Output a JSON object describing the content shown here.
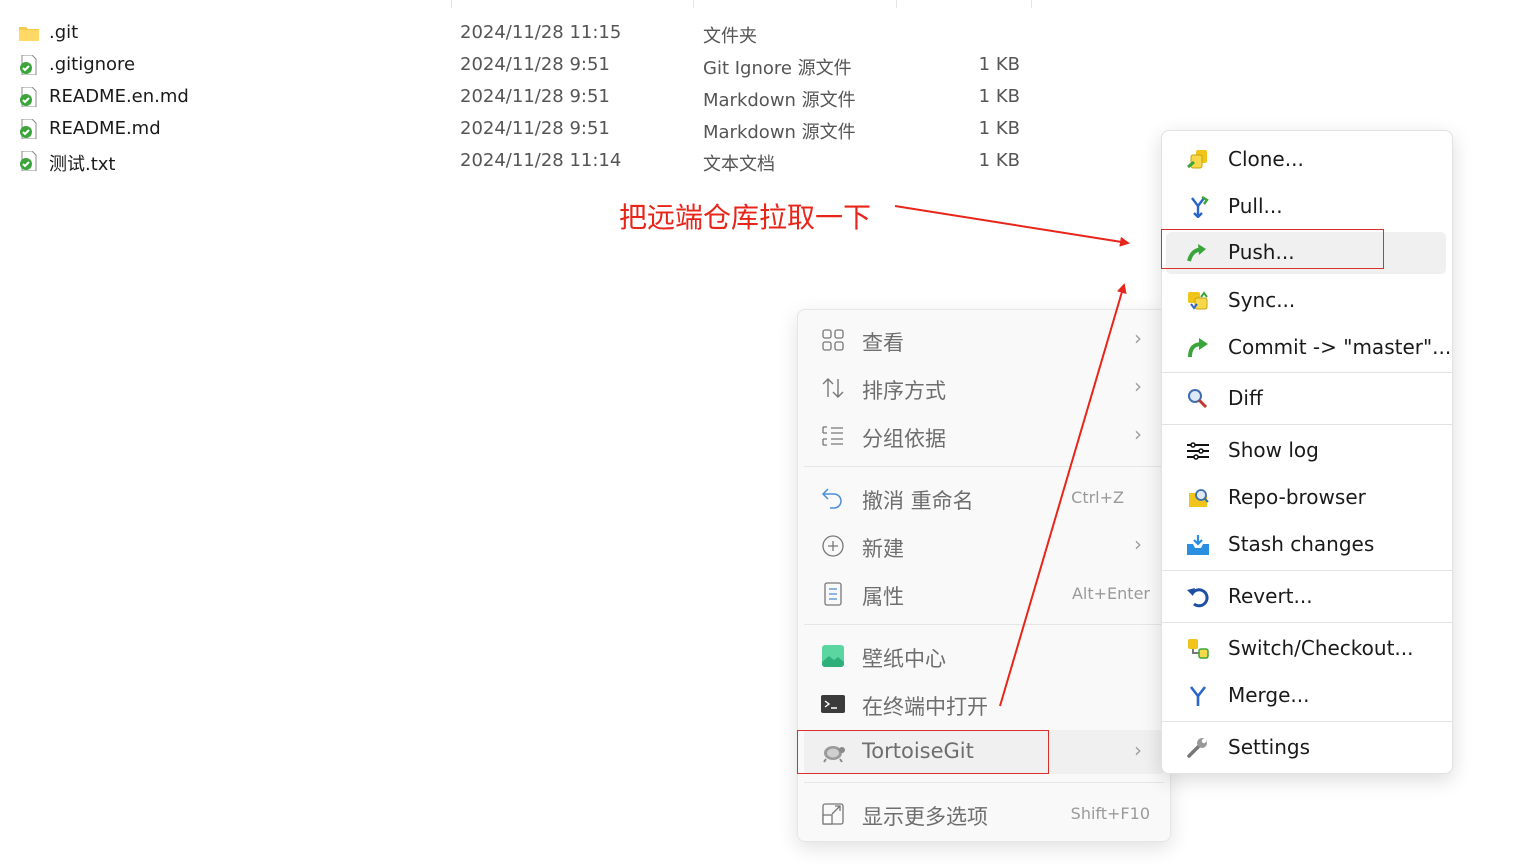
{
  "files": [
    {
      "name": ".git",
      "date": "2024/11/28 11:15",
      "type": "文件夹",
      "size": "",
      "icon": "folder-icon"
    },
    {
      "name": ".gitignore",
      "date": "2024/11/28 9:51",
      "type": "Git Ignore 源文件",
      "size": "1 KB",
      "icon": "git-file-icon"
    },
    {
      "name": "README.en.md",
      "date": "2024/11/28 9:51",
      "type": "Markdown 源文件",
      "size": "1 KB",
      "icon": "git-file-icon"
    },
    {
      "name": "README.md",
      "date": "2024/11/28 9:51",
      "type": "Markdown 源文件",
      "size": "1 KB",
      "icon": "git-file-icon"
    },
    {
      "name": "测试.txt",
      "date": "2024/11/28 11:14",
      "type": "文本文档",
      "size": "1 KB",
      "icon": "git-file-icon"
    }
  ],
  "annotation": {
    "text": "把远端仓库拉取一下",
    "color": "#e8251a"
  },
  "context_menu": {
    "items": [
      {
        "label": "查看",
        "icon": "view-grid-icon",
        "has_submenu": true
      },
      {
        "label": "排序方式",
        "icon": "sort-icon",
        "has_submenu": true
      },
      {
        "label": "分组依据",
        "icon": "group-list-icon",
        "has_submenu": true
      },
      {
        "label": "撤消 重命名",
        "icon": "undo-icon",
        "shortcut": "Ctrl+Z"
      },
      {
        "label": "新建",
        "icon": "new-plus-icon",
        "has_submenu": true
      },
      {
        "label": "属性",
        "icon": "properties-icon",
        "shortcut": "Alt+Enter"
      },
      {
        "label": "壁纸中心",
        "icon": "wallpaper-icon"
      },
      {
        "label": "在终端中打开",
        "icon": "terminal-icon"
      },
      {
        "label": "TortoiseGit",
        "icon": "tortoise-icon",
        "has_submenu": true,
        "highlighted": true
      },
      {
        "label": "显示更多选项",
        "icon": "more-options-icon",
        "shortcut": "Shift+F10"
      }
    ]
  },
  "tortoisegit_submenu": {
    "items": [
      {
        "label": "Clone...",
        "icon": "clone-icon"
      },
      {
        "label": "Pull...",
        "icon": "pull-icon"
      },
      {
        "label": "Push...",
        "icon": "push-icon",
        "active": true
      },
      {
        "label": "Sync...",
        "icon": "sync-icon"
      },
      {
        "label": "Commit -> \"master\"...",
        "icon": "commit-icon"
      },
      {
        "label": "Diff",
        "icon": "diff-magnifier-icon"
      },
      {
        "label": "Show log",
        "icon": "show-log-icon"
      },
      {
        "label": "Repo-browser",
        "icon": "repo-browser-icon"
      },
      {
        "label": "Stash changes",
        "icon": "stash-icon"
      },
      {
        "label": "Revert...",
        "icon": "revert-icon"
      },
      {
        "label": "Switch/Checkout...",
        "icon": "switch-checkout-icon"
      },
      {
        "label": "Merge...",
        "icon": "merge-icon"
      },
      {
        "label": "Settings",
        "icon": "settings-wrench-icon"
      }
    ]
  },
  "colors": {
    "highlight_border": "#d9302a",
    "annotation": "#e8251a",
    "git_green": "#3aa53a"
  }
}
